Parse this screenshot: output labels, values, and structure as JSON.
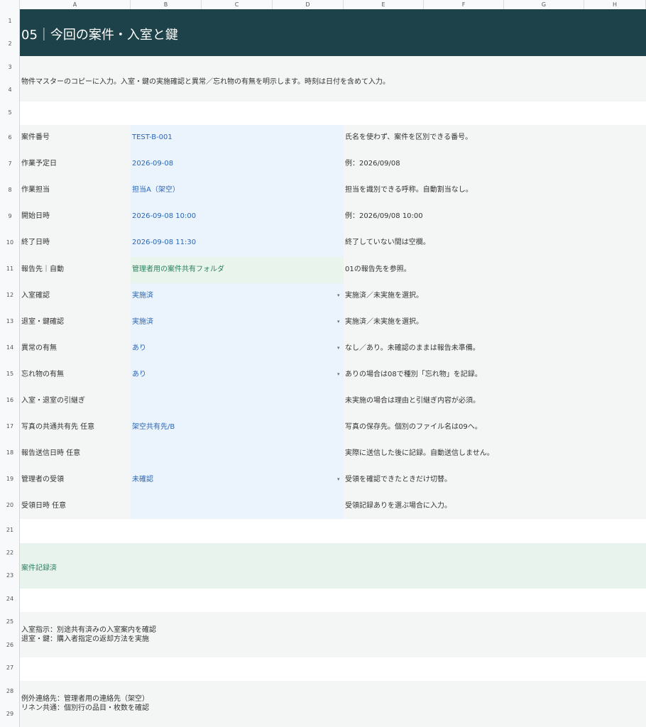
{
  "sheet": {
    "columns": [
      "A",
      "B",
      "C",
      "D",
      "E",
      "F",
      "G",
      "H"
    ],
    "rows": [
      "1",
      "2",
      "3",
      "4",
      "5",
      "6",
      "7",
      "8",
      "9",
      "10",
      "11",
      "12",
      "13",
      "14",
      "15",
      "16",
      "17",
      "18",
      "19",
      "20",
      "21",
      "22",
      "23",
      "24",
      "25",
      "26",
      "27",
      "28",
      "29"
    ],
    "title": "05｜今回の案件・入室と鍵",
    "description": "物件マスターのコピーに入力。入室・鍵の実施確認と異常／忘れ物の有無を明示します。時刻は日付を含めて入力。",
    "fields": [
      {
        "label": "案件番号",
        "value": "TEST-B-001",
        "note": "氏名を使わず、案件を区別できる番号。"
      },
      {
        "label": "作業予定日",
        "value": "2026-09-08",
        "note": "例：2026/09/08"
      },
      {
        "label": "作業担当",
        "value": "担当A（架空）",
        "note": "担当を識別できる呼称。自動割当なし。"
      },
      {
        "label": "開始日時",
        "value": "2026-09-08 10:00",
        "note": "例：2026/09/08 10:00"
      },
      {
        "label": "終了日時",
        "value": "2026-09-08 11:30",
        "note": "終了していない間は空欄。"
      },
      {
        "label": "報告先｜自動",
        "value": "管理者用の案件共有フォルダ",
        "note": "01の報告先を参照。"
      },
      {
        "label": "入室確認",
        "value": "実施済",
        "note": "実施済／未実施を選択。"
      },
      {
        "label": "退室・鍵確認",
        "value": "実施済",
        "note": "実施済／未実施を選択。"
      },
      {
        "label": "異常の有無",
        "value": "あり",
        "note": "なし／あり。未確認のままは報告未準備。"
      },
      {
        "label": "忘れ物の有無",
        "value": "あり",
        "note": "ありの場合は08で種別「忘れ物」を記録。"
      },
      {
        "label": "入室・退室の引継ぎ",
        "value": "",
        "note": "未実施の場合は理由と引継ぎ内容が必須。"
      },
      {
        "label": "写真の共通共有先 任意",
        "value": "架空共有先/B",
        "note": "写真の保存先。個別のファイル名は09へ。"
      },
      {
        "label": "報告送信日時 任意",
        "value": "",
        "note": "実際に送信した後に記録。自動送信しません。"
      },
      {
        "label": "管理者の受領",
        "value": "未確認",
        "note": "受領を確認できたときだけ切替。"
      },
      {
        "label": "受領日時 任意",
        "value": "",
        "note": "受領記録ありを選ぶ場合に入力。"
      }
    ],
    "dropdown_arrow": "▾",
    "status": "案件記録済",
    "instructions": [
      "入室指示：別途共有済みの入室案内を確認",
      "退室・鍵：購入者指定の返却方法を実施"
    ],
    "exceptions": [
      "例外連絡先：管理者用の連絡先（架空）",
      "リネン共通：個別行の品目・枚数を確認"
    ]
  }
}
